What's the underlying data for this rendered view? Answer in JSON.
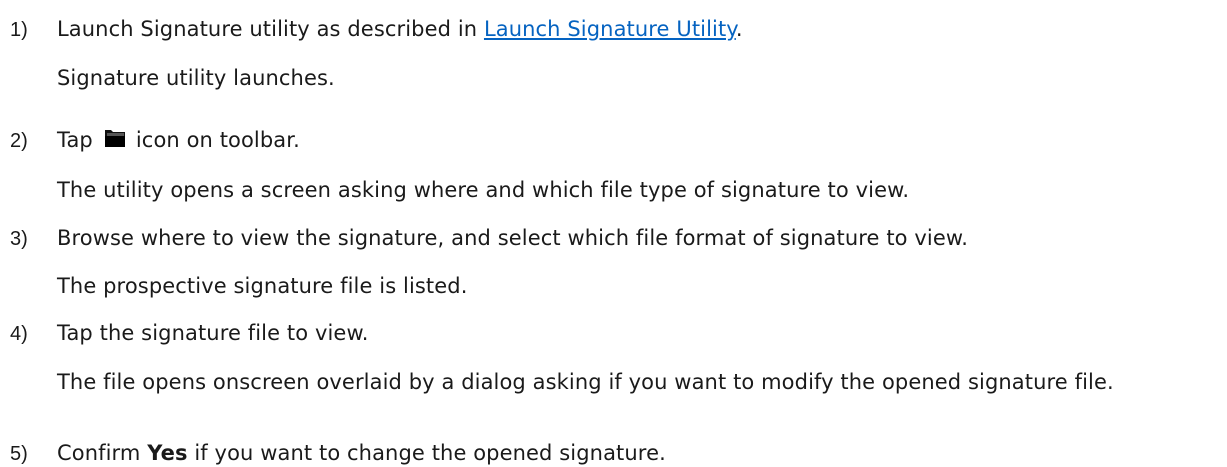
{
  "steps": [
    {
      "number": "1)",
      "text_before": "Launch Signature utility as described in ",
      "link_text": "Launch Signature Utility",
      "text_after": ".",
      "result": "Signature utility launches."
    },
    {
      "number": "2)",
      "text_before": "Tap",
      "icon": "folder-icon",
      "text_after": "icon on toolbar.",
      "result": "The utility opens a screen asking where and which file type of signature to view."
    },
    {
      "number": "3)",
      "text": "Browse where to view the signature, and select which file format of signature to view.",
      "result": "The prospective signature file is listed."
    },
    {
      "number": "4)",
      "text": "Tap the signature file to view.",
      "result": "The file opens onscreen overlaid by a dialog asking if you want to modify the opened signature file."
    },
    {
      "number": "5)",
      "text_before": "Confirm ",
      "bold_text": "Yes",
      "text_after": " if you want to change the opened signature."
    }
  ],
  "colors": {
    "text": "#1a1a1a",
    "link": "#0563c1"
  }
}
